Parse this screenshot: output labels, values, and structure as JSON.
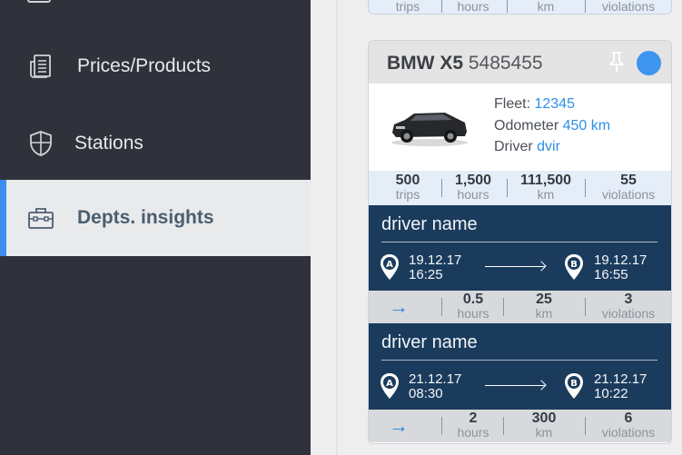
{
  "sidebar": {
    "items": [
      {
        "label": "Prices/Products",
        "icon": "document-list-icon"
      },
      {
        "label": "Stations",
        "icon": "shield-icon"
      },
      {
        "label": "Depts. insights",
        "icon": "briefcase-icon",
        "active": true
      }
    ]
  },
  "top_stats_partial": {
    "trips": "trips",
    "hours": "hours",
    "km": "km",
    "violations": "violations"
  },
  "vehicle": {
    "make_model": "BMW X5",
    "plate": "5485455",
    "fleet_label": "Fleet:",
    "fleet": "12345",
    "odometer_label": "Odometer",
    "odometer": "450 km",
    "driver_label": "Driver",
    "driver": "dvir",
    "stats": {
      "trips": "500",
      "trips_unit": "trips",
      "hours": "1,500",
      "hours_unit": "hours",
      "km": "111,500",
      "km_unit": "km",
      "violations": "55",
      "violations_unit": "violations"
    }
  },
  "trips": [
    {
      "driver": "driver name",
      "start_date": "19.12.17",
      "start_time": "16:25",
      "end_date": "19.12.17",
      "end_time": "16:55",
      "hours": "0.5",
      "hours_unit": "hours",
      "km": "25",
      "km_unit": "km",
      "violations": "3",
      "violations_unit": "violations"
    },
    {
      "driver": "driver name",
      "start_date": "21.12.17",
      "start_time": "08:30",
      "end_date": "21.12.17",
      "end_time": "10:22",
      "hours": "2",
      "hours_unit": "hours",
      "km": "300",
      "km_unit": "km",
      "violations": "6",
      "violations_unit": "violations"
    }
  ],
  "colors": {
    "accent": "#3f8df0",
    "status": "#3d95f0",
    "trip_bg": "#1b3b5c",
    "link": "#2f8fe6"
  }
}
